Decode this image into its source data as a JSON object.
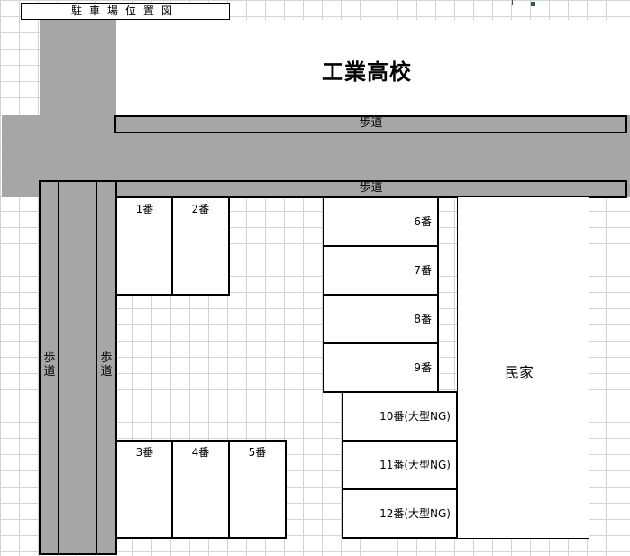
{
  "title": "駐車場位置図",
  "school": "工業高校",
  "sidewalk": "歩道",
  "house": "民家",
  "spots": {
    "s1": "1番",
    "s2": "2番",
    "s3": "3番",
    "s4": "4番",
    "s5": "5番",
    "s6": "6番",
    "s7": "7番",
    "s8": "8番",
    "s9": "9番",
    "s10": "10番(大型NG)",
    "s11": "11番(大型NG)",
    "s12": "12番(大型NG)"
  },
  "colors": {
    "road": "#a6a6a6",
    "grid": "#d4d4d4",
    "selection": "#1f5f5f"
  }
}
